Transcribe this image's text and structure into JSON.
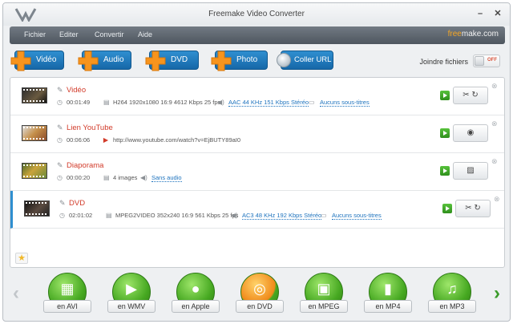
{
  "window": {
    "title": "Freemake Video Converter",
    "minimize": "–",
    "close": "✕"
  },
  "menu": {
    "items": [
      "Fichier",
      "Editer",
      "Convertir",
      "Aide"
    ],
    "brand_prefix": "free",
    "brand_suffix": "make.com"
  },
  "toolbar": {
    "buttons": [
      "Vidéo",
      "Audio",
      "DVD",
      "Photo"
    ],
    "coller_url": "Coller URL",
    "joindre": "Joindre fichiers",
    "toggle_state": "OFF"
  },
  "rows": [
    {
      "name": "Vidéo",
      "duration": "00:01:49",
      "meta": "H264  1920x1080  16:9  4612 Kbps  25 fps",
      "audio": "AAC  44 KHz  151 Kbps  Stéréo",
      "subs": "Aucuns sous-titres"
    },
    {
      "name": "Lien YouTube",
      "duration": "00:06:06",
      "meta": "http://www.youtube.com/watch?v=EjBUTY89aI0"
    },
    {
      "name": "Diaporama",
      "duration": "00:00:20",
      "meta": "4 images",
      "audio": "Sans audio"
    },
    {
      "name": "DVD",
      "duration": "02:01:02",
      "meta": "MPEG2VIDEO  352x240  16:9  561 Kbps  25 fps",
      "audio": "AC3  48 KHz  192 Kbps  Stéréo",
      "subs": "Aucuns sous-titres"
    }
  ],
  "formats": [
    "en AVI",
    "en WMV",
    "en Apple",
    "en DVD",
    "en MPEG",
    "en MP4",
    "en MP3"
  ],
  "colors": {
    "accent_blue": "#1e73be",
    "name_red": "#d23b2a",
    "format_green": "#46a821",
    "brand_orange": "#f5a623"
  }
}
